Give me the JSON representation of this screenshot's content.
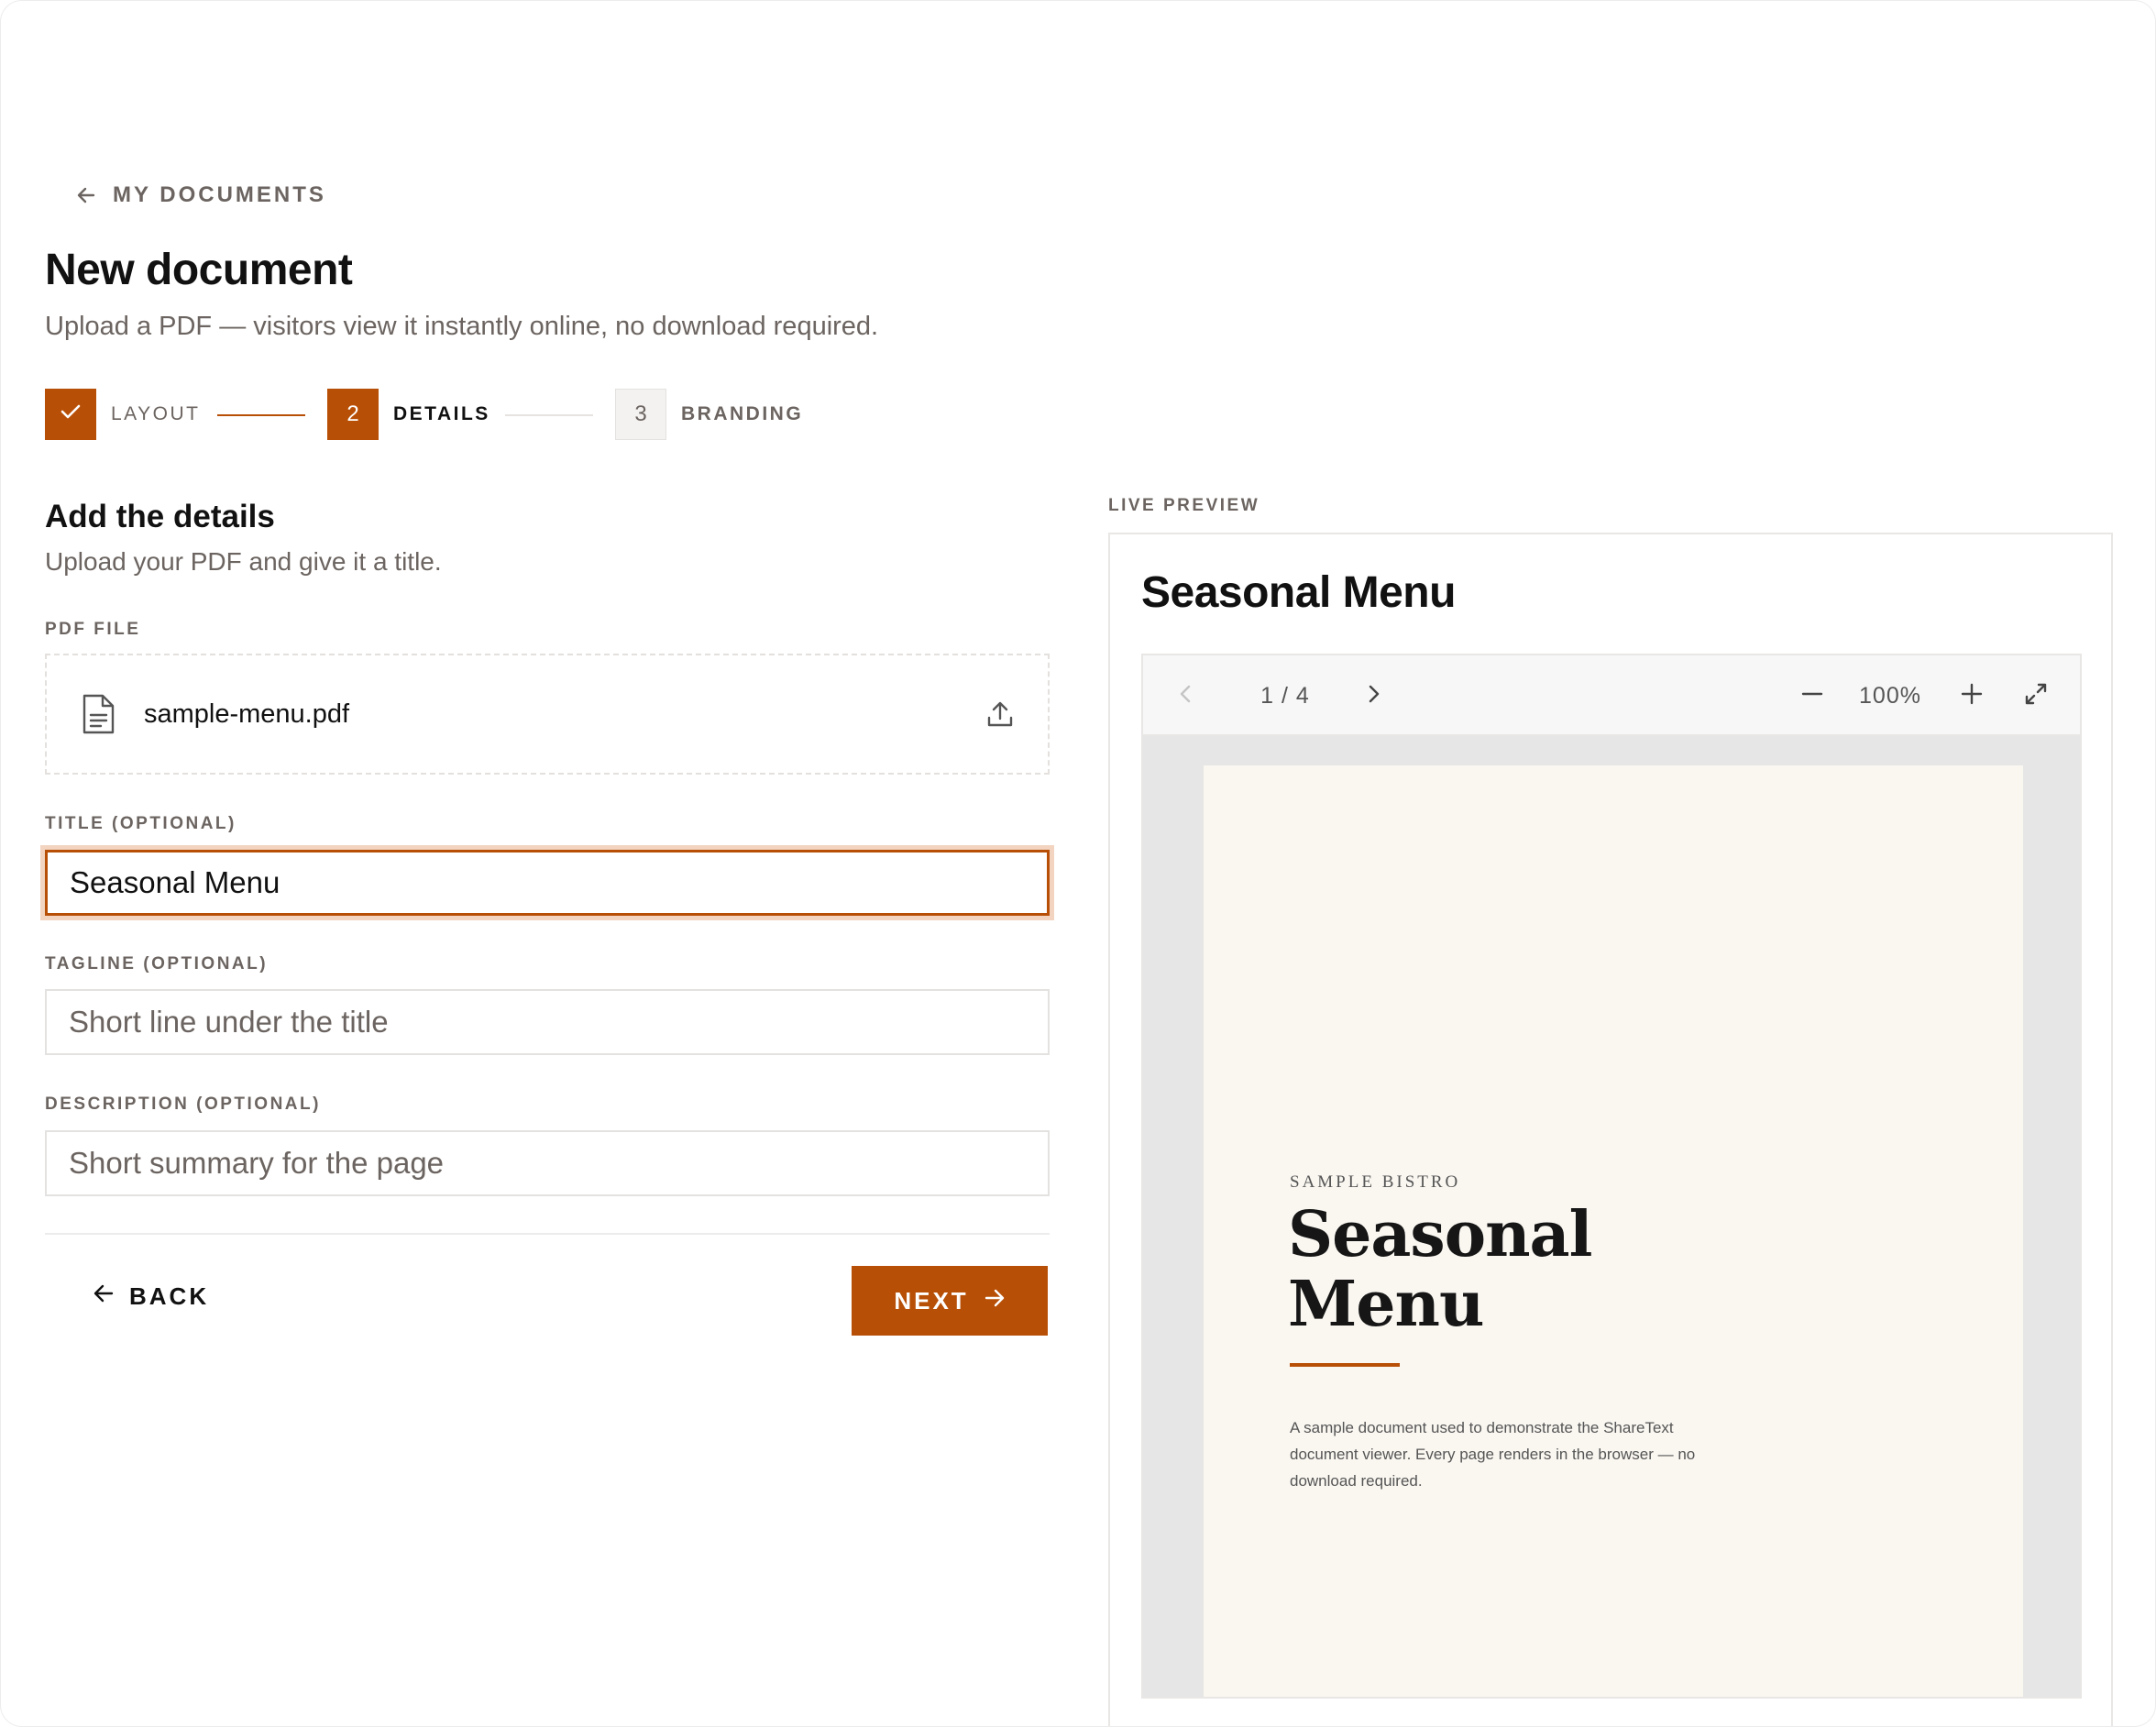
{
  "nav": {
    "back_label": "MY DOCUMENTS"
  },
  "header": {
    "title": "New document",
    "subtitle": "Upload a PDF — visitors view it instantly online, no download required."
  },
  "stepper": {
    "steps": [
      {
        "number": "",
        "label": "LAYOUT",
        "state": "done"
      },
      {
        "number": "2",
        "label": "DETAILS",
        "state": "active"
      },
      {
        "number": "3",
        "label": "BRANDING",
        "state": "todo"
      }
    ]
  },
  "form": {
    "section_title": "Add the details",
    "section_subtitle": "Upload your PDF and give it a title.",
    "pdf_label": "PDF FILE",
    "pdf_filename": "sample-menu.pdf",
    "title_label": "TITLE (OPTIONAL)",
    "title_value": "Seasonal Menu",
    "tagline_label": "TAGLINE (OPTIONAL)",
    "tagline_placeholder": "Short line under the title",
    "description_label": "DESCRIPTION (OPTIONAL)",
    "description_placeholder": "Short summary for the page",
    "back_button": "BACK",
    "next_button": "NEXT"
  },
  "preview": {
    "label": "LIVE PREVIEW",
    "title": "Seasonal Menu",
    "toolbar": {
      "page_indicator": "1 / 4",
      "zoom": "100%"
    },
    "document": {
      "eyebrow": "SAMPLE BISTRO",
      "heading_line1": "Seasonal",
      "heading_line2": "Menu",
      "body": "A sample document used to demonstrate the ShareText document viewer. Every page renders in the browser — no download required."
    }
  },
  "colors": {
    "accent": "#b84f06",
    "muted_text": "#6b6460",
    "page_bg": "#faf7f1"
  }
}
